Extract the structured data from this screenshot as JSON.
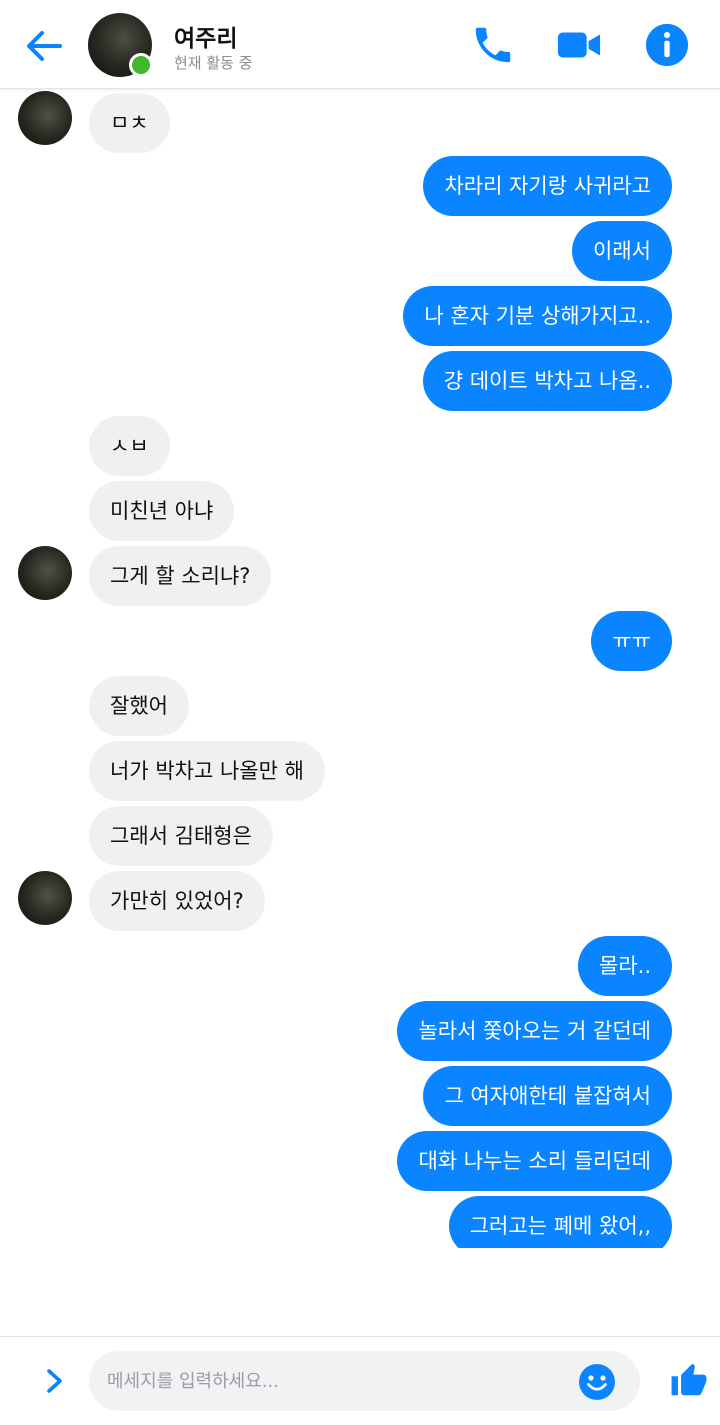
{
  "header": {
    "name": "여주리",
    "status": "현재 활동 중"
  },
  "messages": [
    {
      "from": "them",
      "text": "ㅁㅊ"
    },
    {
      "from": "me",
      "text": "차라리 자기랑 사귀라고"
    },
    {
      "from": "me",
      "text": "이래서"
    },
    {
      "from": "me",
      "text": "나 혼자 기분 상해가지고.."
    },
    {
      "from": "me",
      "text": "걍 데이트 박차고 나옴.."
    },
    {
      "from": "them",
      "text": "ㅅㅂ"
    },
    {
      "from": "them",
      "text": "미친년 아냐"
    },
    {
      "from": "them",
      "text": "그게 할 소리냐?"
    },
    {
      "from": "me",
      "text": "ㅠㅠ"
    },
    {
      "from": "them",
      "text": "잘했어"
    },
    {
      "from": "them",
      "text": "너가 박차고 나올만 해"
    },
    {
      "from": "them",
      "text": "그래서 김태형은"
    },
    {
      "from": "them",
      "text": "가만히 있었어?"
    },
    {
      "from": "me",
      "text": "몰라.."
    },
    {
      "from": "me",
      "text": "놀라서 쫓아오는 거 같던데"
    },
    {
      "from": "me",
      "text": "그 여자애한테 붙잡혀서"
    },
    {
      "from": "me",
      "text": "대화 나누는 소리 들리던데"
    },
    {
      "from": "me",
      "text": "그러고는 폐메 왔어,,"
    }
  ],
  "composer": {
    "placeholder": "메세지를 입력하세요..."
  },
  "colors": {
    "accent": "#0a84ff",
    "incoming_bubble": "#f1f0f0",
    "online": "#42b72a"
  },
  "icons": [
    "back-arrow-icon",
    "phone-icon",
    "video-camera-icon",
    "info-icon",
    "chevron-right-icon",
    "smiley-icon",
    "thumbs-up-icon"
  ]
}
